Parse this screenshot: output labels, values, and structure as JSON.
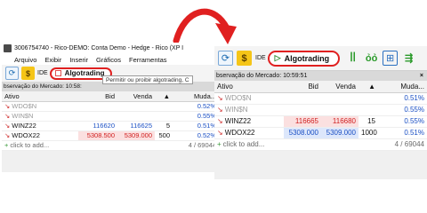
{
  "left_window": {
    "title": "3006754740 - Rico-DEMO: Conta Demo - Hedge - Rico (XP I",
    "menu": [
      "Arquivo",
      "Exibir",
      "Inserir",
      "Gráficos",
      "Ferramentas"
    ],
    "toolbar": {
      "ide_label": "IDE",
      "algo_label": "Algotrading"
    },
    "tooltip": "Permitir ou proibir algotrading, C",
    "panel_title": "bservação do Mercado: 10:58:",
    "columns": {
      "ativo": "Ativo",
      "bid": "Bid",
      "venda": "Venda",
      "sort": "▲",
      "mud": "Muda..."
    },
    "rows": [
      {
        "symbol": "WDO$N",
        "bid": "",
        "venda": "",
        "qty": "",
        "change": "0.52%"
      },
      {
        "symbol": "WIN$N",
        "bid": "",
        "venda": "",
        "qty": "",
        "change": "0.55%"
      },
      {
        "symbol": "WINZ22",
        "bid": "116620",
        "venda": "116625",
        "qty": "5",
        "change": "0.51%"
      },
      {
        "symbol": "WDOX22",
        "bid": "5308.500",
        "venda": "5309.000",
        "qty": "500",
        "change": "0.52%"
      }
    ],
    "add_row": {
      "label": "click to add...",
      "count": "4 / 69044"
    }
  },
  "right_window": {
    "toolbar": {
      "ide_label": "IDE",
      "algo_label": "Algotrading"
    },
    "panel_title": "bservação do Mercado: 10:59:51",
    "close": "×",
    "columns": {
      "ativo": "Ativo",
      "bid": "Bid",
      "venda": "Venda",
      "sort": "▲",
      "mud": "Muda..."
    },
    "rows": [
      {
        "symbol": "WDO$N",
        "bid": "",
        "venda": "",
        "qty": "",
        "change": "0.51%"
      },
      {
        "symbol": "WIN$N",
        "bid": "",
        "venda": "",
        "qty": "",
        "change": "0.55%"
      },
      {
        "symbol": "WINZ22",
        "bid": "116665",
        "venda": "116680",
        "qty": "15",
        "change": "0.55%"
      },
      {
        "symbol": "WDOX22",
        "bid": "5308.000",
        "venda": "5309.000",
        "qty": "1000",
        "change": "0.51%"
      }
    ],
    "add_row": {
      "label": "click to add...",
      "count": "4 / 69044"
    }
  },
  "colors": {
    "accent_red": "#e02020",
    "bid_blue": "#1a4fc4",
    "ask_red": "#d02020"
  },
  "icons": [
    "refresh-icon",
    "dollar-icon",
    "play-icon",
    "checkbox-icon",
    "grid-icon",
    "arrow-icon"
  ]
}
